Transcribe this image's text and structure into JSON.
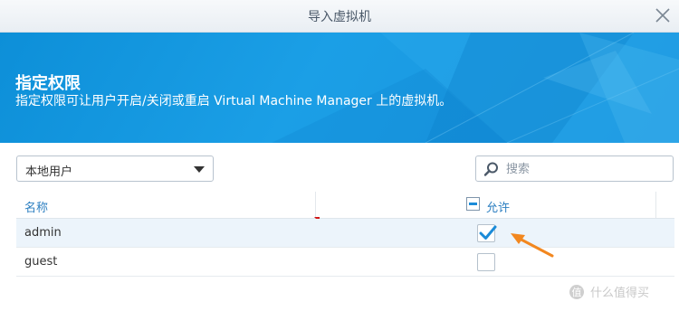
{
  "window": {
    "title": "导入虚拟机"
  },
  "banner": {
    "heading": "指定权限",
    "description": "指定权限可让用户开启/关闭或重启 Virtual Machine Manager 上的虚拟机。"
  },
  "user_type_select": {
    "selected": "本地用户"
  },
  "search": {
    "placeholder": "搜索"
  },
  "table": {
    "columns": {
      "name": "名称",
      "allow": "允许"
    },
    "header_allow_state": "partial",
    "rows": [
      {
        "name": "admin",
        "allowed": true,
        "selected": true
      },
      {
        "name": "guest",
        "allowed": false,
        "selected": false
      }
    ]
  },
  "watermark": {
    "text": "什么值得买"
  },
  "colors": {
    "accent": "#1b8bd8",
    "banner": "#1697e0",
    "annotation_arrow": "#f2871f"
  }
}
